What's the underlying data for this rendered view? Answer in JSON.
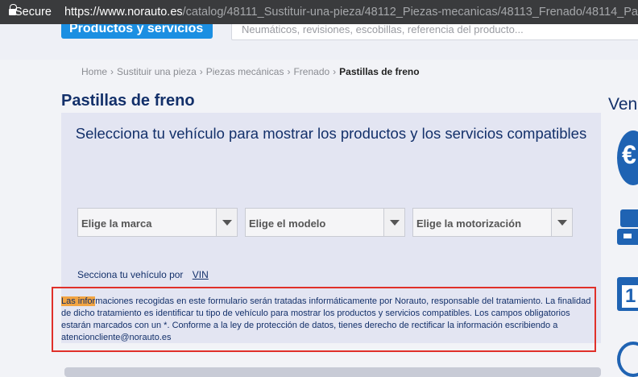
{
  "browser": {
    "secure_label": "Secure",
    "url_host": "https://www.norauto.es",
    "url_path": "/catalog/48111_Sustituir-una-pieza/48112_Piezas-mecanicas/48113_Frenado/48114_Pa"
  },
  "header": {
    "products_button": "Productos y servicios",
    "search_placeholder": "Neumáticos, revisiones, escobillas, referencia del producto..."
  },
  "breadcrumb": {
    "items": [
      "Home",
      "Sustituir una pieza",
      "Piezas mecánicas",
      "Frenado"
    ],
    "current": "Pastillas de freno",
    "separator": "›"
  },
  "page_title": "Pastillas de freno",
  "right_heading": "Ven",
  "vehicle_selector": {
    "title": "Selecciona tu vehículo para mostrar los productos y los servicios compatibles",
    "selects": [
      {
        "selected": "Elige la marca"
      },
      {
        "selected": "Elige el modelo"
      },
      {
        "selected": "Elige la motorización"
      }
    ],
    "vin_label": "Secciona tu vehículo por",
    "vin_link": "VIN"
  },
  "legal": {
    "highlight": "Las infor",
    "text": "maciones recogidas en este formulario serán tratadas informáticamente por Norauto, responsable del tratamiento. La finalidad de dicho tratamiento es identificar tu tipo de vehículo para mostrar los productos y servicios compatibles. Los campos obligatorios estarán marcados con un *. Conforme a la ley de protección de datos, tienes derecho de rectificar la información escribiendo a atencioncliente@norauto.es"
  },
  "side_icons": {
    "euro_symbol": "€",
    "calendar_number": "1"
  },
  "colors": {
    "brand_blue": "#13306a",
    "button_blue": "#1b8fe2",
    "annotation_red": "#e0302a",
    "highlight_orange": "#f2a442"
  }
}
